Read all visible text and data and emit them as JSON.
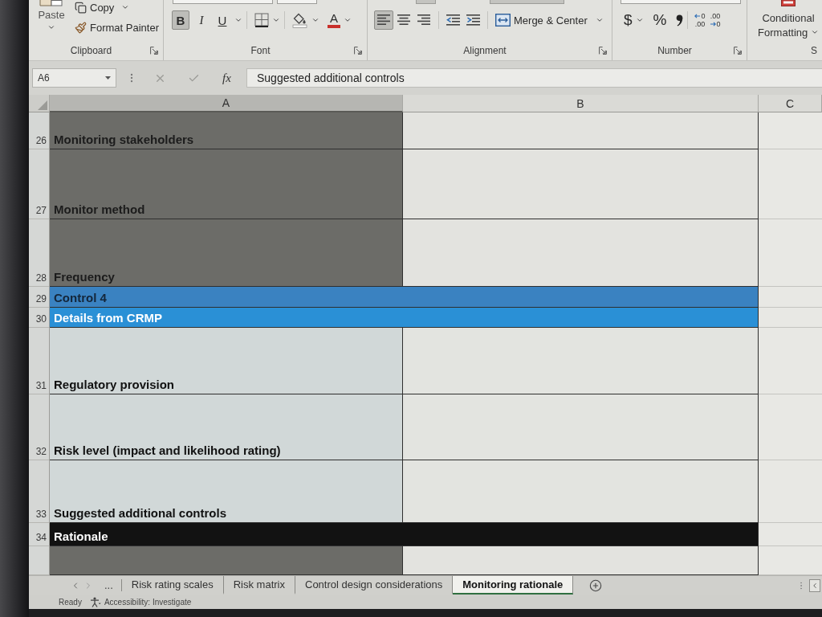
{
  "ribbon": {
    "clipboard": {
      "label": "Clipboard",
      "paste": "Paste",
      "copy": "Copy",
      "format_painter": "Format Painter"
    },
    "font": {
      "label": "Font",
      "styles": [
        {
          "kind": "bold",
          "text": "B",
          "on": true
        },
        {
          "kind": "italic",
          "text": "I",
          "on": false
        },
        {
          "kind": "underline",
          "text": "U",
          "on": false
        }
      ],
      "font_color": "A"
    },
    "alignment": {
      "label": "Alignment",
      "align": [
        {
          "kind": "left",
          "on": true
        },
        {
          "kind": "center",
          "on": false
        },
        {
          "kind": "right",
          "on": false
        }
      ],
      "merge": "Merge & Center"
    },
    "number": {
      "label": "Number",
      "currency": "$",
      "percent": "%",
      "decimals": [
        {
          "kind": "increase",
          "upper": "0",
          "lower": ".00"
        },
        {
          "kind": "decrease",
          "upper": ".00",
          "lower": "0"
        }
      ]
    },
    "styles": {
      "label": "S",
      "conditional_formatting": "Conditional Formatting"
    }
  },
  "formula_bar": {
    "name_box": "A6",
    "function_label": "fx",
    "formula": "Suggested additional controls"
  },
  "columns": [
    {
      "label": "A",
      "selected": true
    },
    {
      "label": "B",
      "selected": false
    },
    {
      "label": "C",
      "selected": false
    }
  ],
  "rows": [
    {
      "number": "26",
      "label": "Monitoring stakeholders",
      "kind": "shaded"
    },
    {
      "number": "27",
      "label": "Monitor method",
      "kind": "shaded"
    },
    {
      "number": "28",
      "label": "Frequency",
      "kind": "shaded"
    },
    {
      "number": "29",
      "label": "Control 4",
      "kind": "section"
    },
    {
      "number": "30",
      "label": "Details from CRMP",
      "kind": "subsection"
    },
    {
      "number": "31",
      "label": "Regulatory provision",
      "kind": "plain"
    },
    {
      "number": "32",
      "label": "Risk level (impact and likelihood rating)",
      "kind": "plain"
    },
    {
      "number": "33",
      "label": "Suggested additional controls",
      "kind": "plain"
    },
    {
      "number": "34",
      "label": "Rationale",
      "kind": "banner"
    },
    {
      "kind": "shaded"
    }
  ],
  "sheet_tabs": {
    "overflow": "...",
    "tabs": [
      {
        "label": "Risk rating scales",
        "selected": false
      },
      {
        "label": "Risk matrix",
        "selected": false
      },
      {
        "label": "Control design considerations",
        "selected": false
      },
      {
        "label": "Monitoring rationale",
        "selected": true
      }
    ]
  },
  "status_bar": {
    "mode": "Ready",
    "accessibility": "Accessibility: Investigate"
  }
}
